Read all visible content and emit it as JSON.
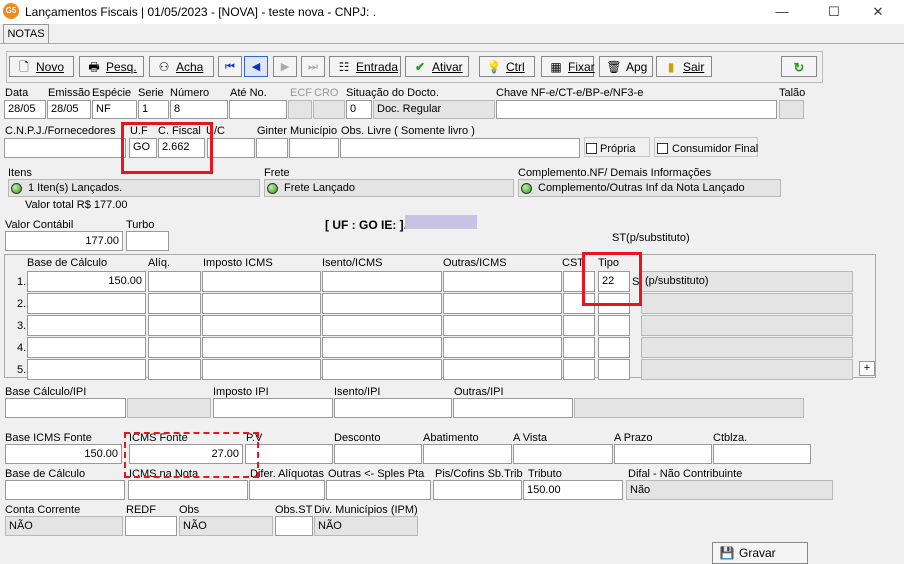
{
  "window": {
    "icon_text": "G5",
    "title": "Lançamentos Fiscais | 01/05/2023 - [NOVA] - teste nova - CNPJ: .",
    "minimize": "—",
    "maximize": "☐",
    "close": "✕"
  },
  "tab": "NOTAS",
  "toolbar": {
    "novo": "Novo",
    "pesq": "Pesq.",
    "acha": "Acha",
    "entrada": "Entrada",
    "ativar": "Ativar",
    "ctrl": "Ctrl",
    "fixar": "Fixar",
    "apg": "Apg",
    "sair": "Sair"
  },
  "header_row": {
    "labels": {
      "data": "Data",
      "emissao": "Emissão",
      "especie": "Espécie",
      "serie": "Serie",
      "numero": "Número",
      "ate_no": "Até No.",
      "ecf": "ECF",
      "cro": "CRO",
      "situacao": "Situação do Docto.",
      "chave": "Chave NF-e/CT-e/BP-e/NF3-e",
      "talao": "Talão"
    },
    "values": {
      "data": "28/05",
      "emissao": "28/05",
      "especie": "NF",
      "serie": "1",
      "numero": "8",
      "situacao_code": "0",
      "situacao_desc": "Doc. Regular"
    }
  },
  "fornecedor_row": {
    "labels": {
      "cnpj": "C.N.P.J./Fornecedores",
      "uf": "U.F",
      "cfiscal": "C. Fiscal",
      "uc": "U/C",
      "ginter": "Ginter",
      "municipio": "Município",
      "obs_livre": "Obs. Livre ( Somente livro )",
      "propria": "Própria",
      "consumidor_final": "Consumidor Final"
    },
    "values": {
      "uf": "GO",
      "cfiscal": "2.662"
    }
  },
  "itens": {
    "label": "Itens",
    "status": "1 Iten(s) Lançados.",
    "valor_total": "Valor total R$ 177.00",
    "frete_label": "Frete",
    "frete_status": "Frete Lançado",
    "complemento_label": "Complemento.NF/ Demais Informações",
    "complemento_status": "Complemento/Outras Inf da Nota Lançado"
  },
  "valor_row": {
    "valor_contabil_label": "Valor Contábil",
    "valor_contabil": "177.00",
    "turbo_label": "Turbo",
    "uf_ie": "[ UF : GO IE: ].",
    "st_label": "ST(p/substituto)"
  },
  "icms_grid": {
    "headers": {
      "base": "Base de Cálculo",
      "aliq": "Alíq.",
      "imposto": "Imposto ICMS",
      "isento": "Isento/ICMS",
      "outras": "Outras/ICMS",
      "cst": "CST",
      "tipo": "Tipo"
    },
    "rows": [
      {
        "n": "1.",
        "base": "150.00",
        "tipo": "22",
        "tipo_code": "S",
        "tipo_desc": "(p/substituto)"
      },
      {
        "n": "2.",
        "base": "",
        "tipo": "",
        "tipo_code": "",
        "tipo_desc": ""
      },
      {
        "n": "3.",
        "base": "",
        "tipo": "",
        "tipo_code": "",
        "tipo_desc": ""
      },
      {
        "n": "4.",
        "base": "",
        "tipo": "",
        "tipo_code": "",
        "tipo_desc": ""
      },
      {
        "n": "5.",
        "base": "",
        "tipo": "",
        "tipo_code": "",
        "tipo_desc": ""
      }
    ],
    "plus": "+"
  },
  "ipi_row": {
    "base": "Base Cálculo/IPI",
    "imposto": "Imposto IPI",
    "isento": "Isento/IPI",
    "outras": "Outras/IPI"
  },
  "fonte_row": {
    "labels": {
      "base_icms_fonte": "Base ICMS Fonte",
      "icms_fonte": "ICMS Fonte",
      "p_v": "P.V",
      "desconto": "Desconto",
      "abatimento": "Abatimento",
      "a_vista": "A Vista",
      "a_prazo": "A Prazo",
      "ctblza": "Ctblza."
    },
    "values": {
      "base_icms_fonte": "150.00",
      "icms_fonte": "27.00"
    }
  },
  "calc_row": {
    "labels": {
      "base": "Base de Cálculo",
      "icms_na_nota": "ICMS na Nota",
      "difer": "Difer. Alíquotas",
      "outras_spl": "Outras <- Sples Pta",
      "pis_cofins": "Pis/Cofins Sb.Trib",
      "tributo": "Tributo",
      "difal": "Difal - Não Contribuinte"
    },
    "values": {
      "tributo": "150.00",
      "difal": "Não"
    }
  },
  "conta_row": {
    "labels": {
      "conta": "Conta Corrente",
      "redf": "REDF",
      "obs": "Obs",
      "obs_st": "Obs.ST",
      "div": "Div. Municípios (IPM)"
    },
    "values": {
      "conta": "NÃO",
      "obs": "NÃO",
      "div": "NÃO"
    }
  },
  "gravar": "Gravar"
}
